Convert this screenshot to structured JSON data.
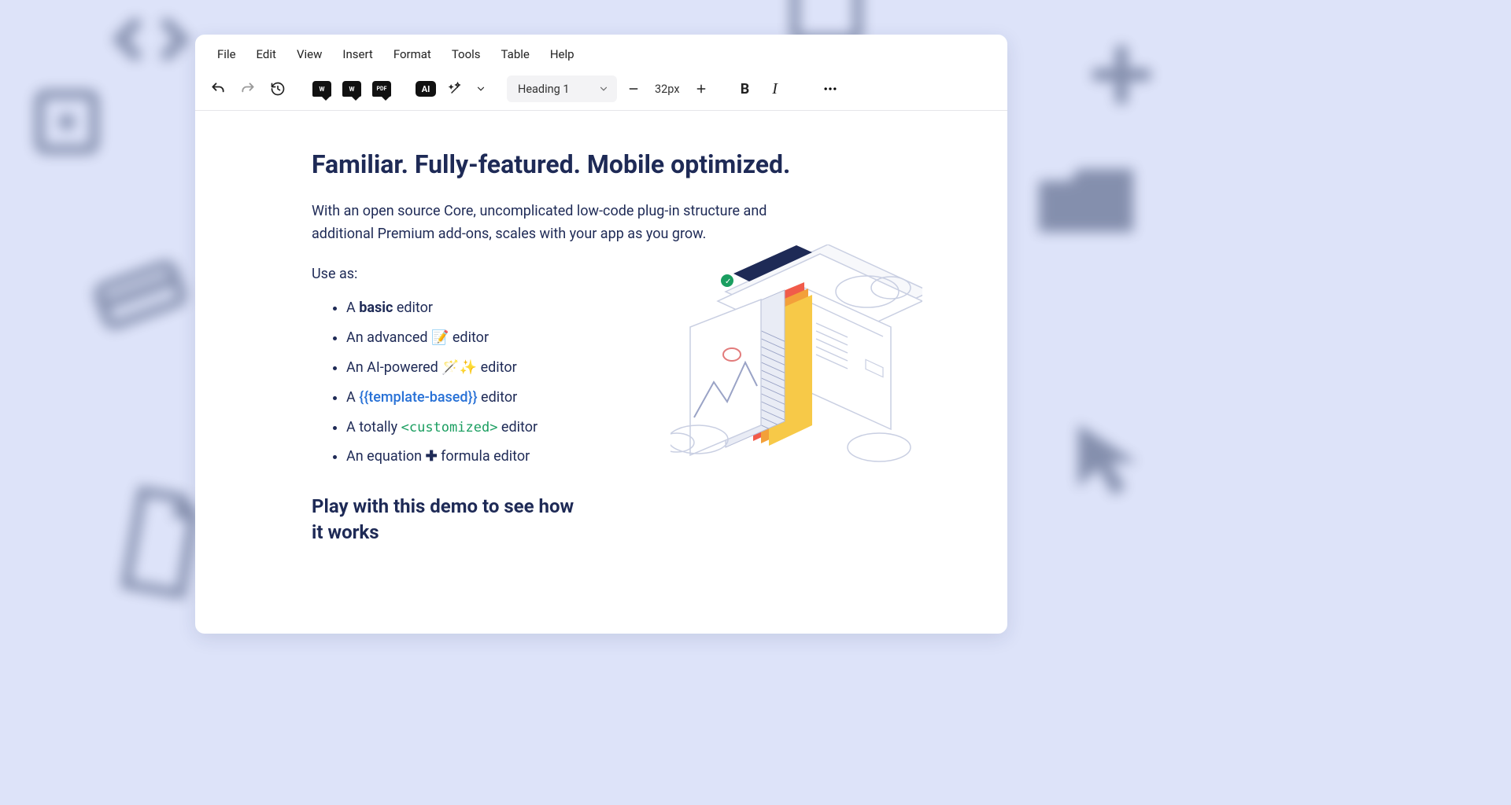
{
  "menubar": {
    "items": [
      "File",
      "Edit",
      "View",
      "Insert",
      "Format",
      "Tools",
      "Table",
      "Help"
    ]
  },
  "toolbar": {
    "format_select": "Heading 1",
    "font_size": "32px",
    "ai_label": "AI"
  },
  "content": {
    "heading": "Familiar. Fully-featured. Mobile optimized.",
    "paragraph": "With an open source Core, uncomplicated low-code plug-in structure and additional Premium add-ons, scales with your app as you grow.",
    "use_as_label": "Use as:",
    "list": {
      "item1_prefix": "A ",
      "item1_bold": "basic",
      "item1_suffix": " editor",
      "item2_prefix": "An advanced ",
      "item2_emoji": "📝",
      "item2_suffix": " editor",
      "item3_prefix": "An AI-powered ",
      "item3_emoji": "🪄✨",
      "item3_suffix": " editor",
      "item4_prefix": "A ",
      "item4_tpl": "{{template-based}}",
      "item4_suffix": " editor",
      "item5_prefix": "A totally ",
      "item5_tpl": "<customized>",
      "item5_suffix": " editor",
      "item6_prefix": "An equation ",
      "item6_symbol": "✚",
      "item6_suffix": " formula editor"
    },
    "subheading": "Play with this demo to see how it works"
  }
}
